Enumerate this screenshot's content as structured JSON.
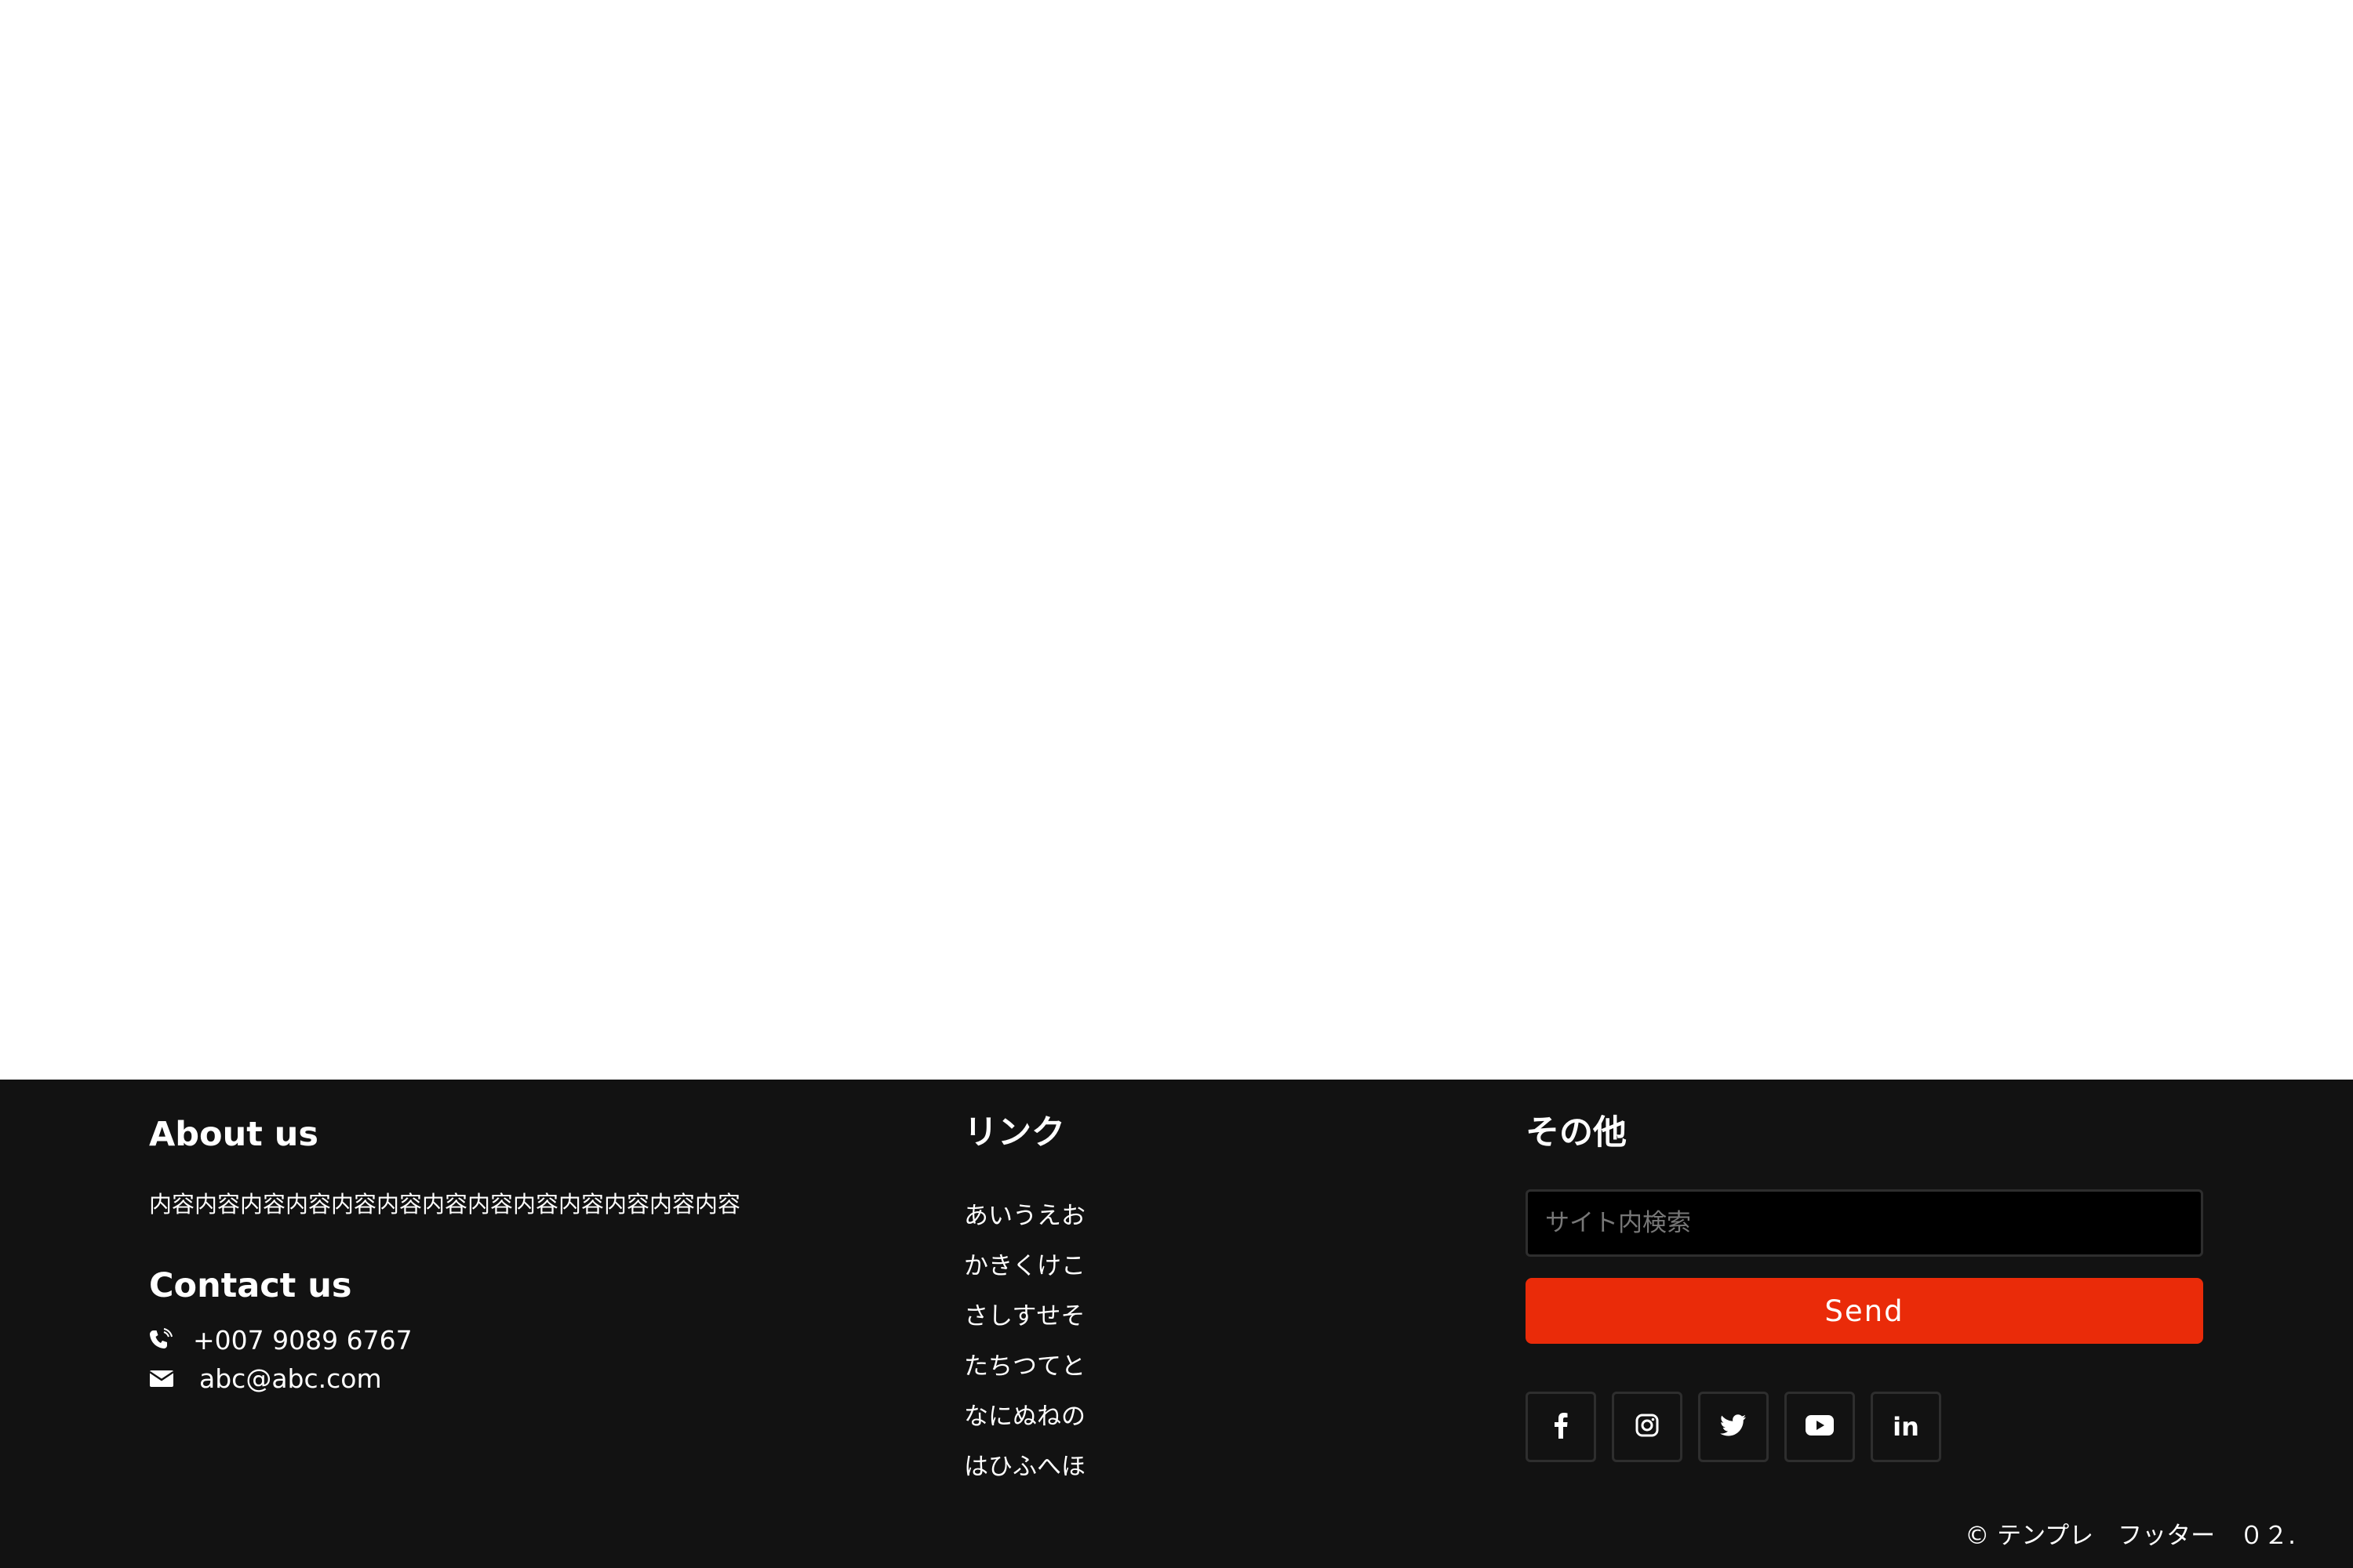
{
  "footer": {
    "about": {
      "heading": "About us",
      "text": "内容内容内容内容内容内容内容内容内容内容内容内容内容"
    },
    "contact": {
      "heading": "Contact us",
      "phone": "+007 9089 6767",
      "email": "abc@abc.com",
      "phone_icon": "phone-icon",
      "email_icon": "envelope-icon"
    },
    "links": {
      "heading": "リンク",
      "items": [
        "あいうえお",
        "かきくけこ",
        "さしすせそ",
        "たちつてと",
        "なにぬねの",
        "はひふへほ"
      ]
    },
    "other": {
      "heading": "その他",
      "search_placeholder": "サイト内検索",
      "search_value": "",
      "send_label": "Send",
      "send_color": "#ea2b09",
      "social": [
        "facebook-icon",
        "instagram-icon",
        "twitter-icon",
        "youtube-icon",
        "linkedin-icon"
      ]
    },
    "copyright": "© テンプレ　フッター　０２.",
    "background_color": "#121212"
  }
}
